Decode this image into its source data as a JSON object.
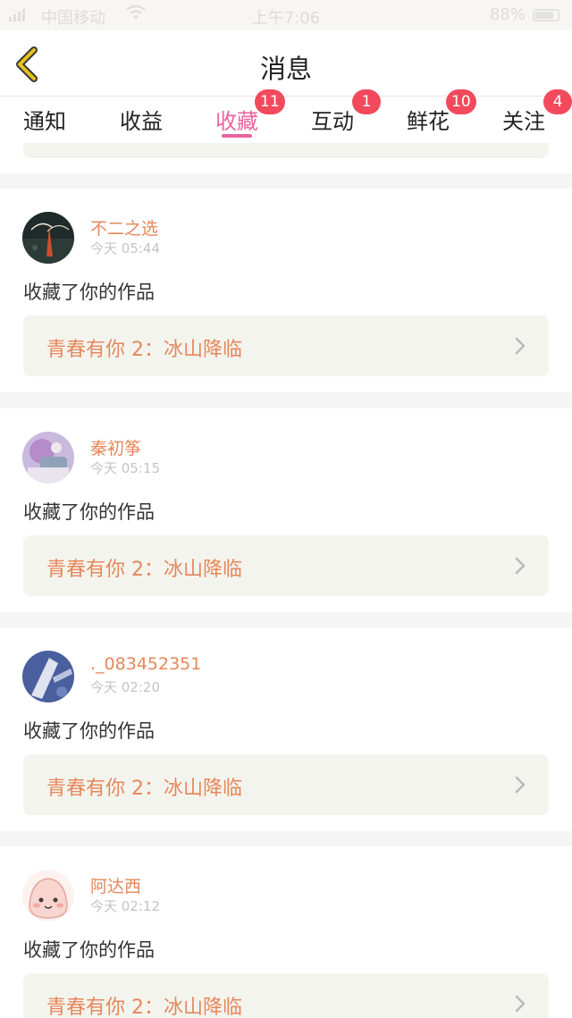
{
  "status_bar": {
    "carrier": "中国移动",
    "time": "上午7:06",
    "battery": "88%"
  },
  "header": {
    "title": "消息",
    "back_icon": "chevron-left-icon",
    "back_color": "#e8c21a"
  },
  "tabs": [
    {
      "label": "通知",
      "badge": ""
    },
    {
      "label": "收益",
      "badge": ""
    },
    {
      "label": "收藏",
      "badge": "11",
      "active": true
    },
    {
      "label": "互动",
      "badge": "1"
    },
    {
      "label": "鲜花",
      "badge": "10"
    },
    {
      "label": "关注",
      "badge": "4"
    }
  ],
  "colors": {
    "accent_pink": "#e8649e",
    "badge_red": "#f24a5c",
    "name_orange": "#e6875b",
    "card_bg": "#f4f4ee"
  },
  "notifications": [
    {
      "username": "不二之选",
      "time": "今天 05:44",
      "action": "收藏了你的作品",
      "work_title": "青春有你 2：冰山降临",
      "avatar": "dark-landscape-avatar"
    },
    {
      "username": "秦初筝",
      "time": "今天 05:15",
      "action": "收藏了你的作品",
      "work_title": "青春有你 2：冰山降临",
      "avatar": "pink-hair-portrait-avatar"
    },
    {
      "username": "._083452351",
      "time": "今天 02:20",
      "action": "收藏了你的作品",
      "work_title": "青春有你 2：冰山降临",
      "avatar": "blue-anime-avatar"
    },
    {
      "username": "阿达西",
      "time": "今天 02:12",
      "action": "收藏了你的作品",
      "work_title": "青春有你 2：冰山降临",
      "avatar": "cute-peach-avatar"
    }
  ]
}
